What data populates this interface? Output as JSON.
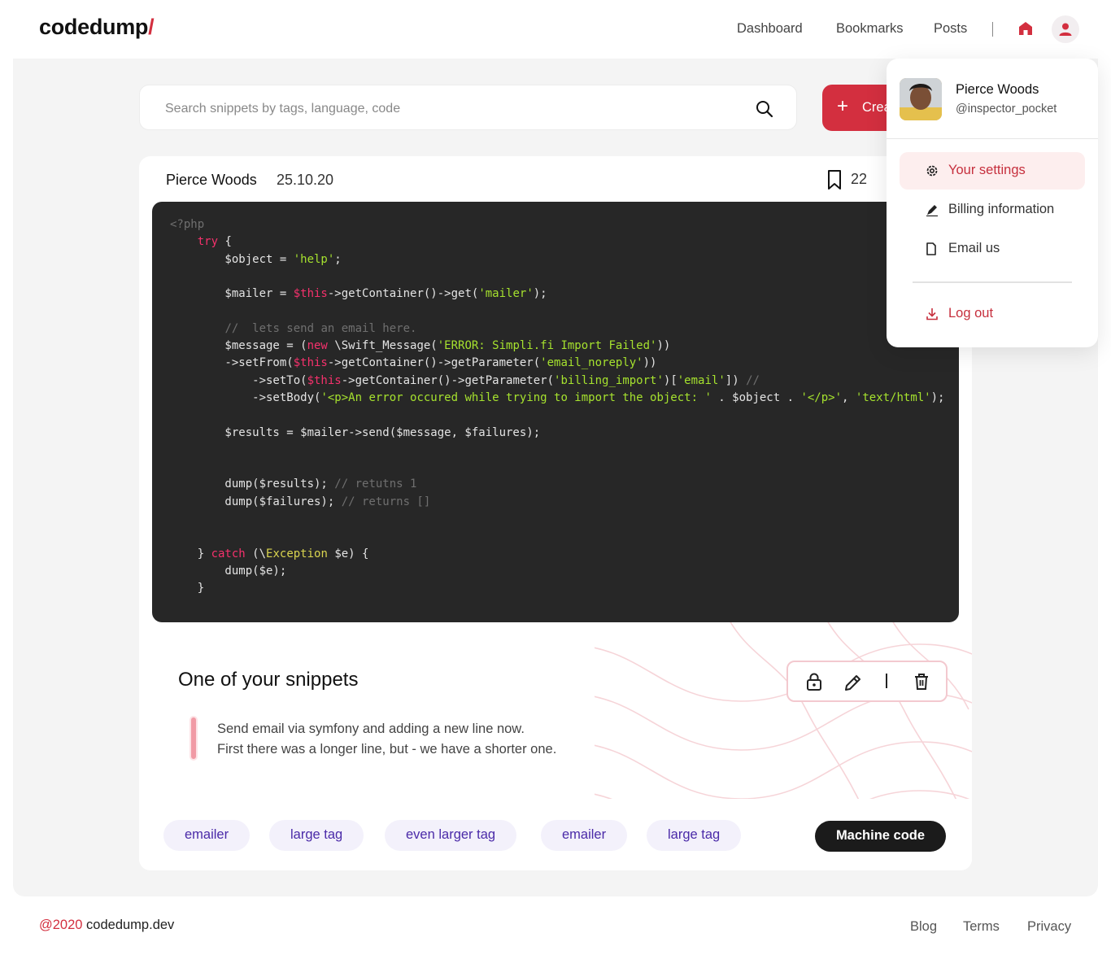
{
  "brand": {
    "name": "codedump",
    "slash": "/"
  },
  "nav": {
    "dashboard": "Dashboard",
    "bookmarks": "Bookmarks",
    "posts": "Posts"
  },
  "colors": {
    "accent": "#d32f3f",
    "tag_bg": "#f3f1fb",
    "tag_text": "#4a2aa8",
    "code_bg": "#272727"
  },
  "icons": {
    "home": "home-icon",
    "user": "user-icon",
    "search": "search-icon",
    "bookmark": "bookmark-icon"
  },
  "search": {
    "placeholder": "Search snippets by tags, language, code"
  },
  "create": {
    "label": "Create"
  },
  "snippet": {
    "author": "Pierce Woods",
    "date": "25.10.20",
    "bookmarks": "22",
    "title": "One of your snippets",
    "description_line1": "Send email via symfony and adding a new line now.",
    "description_line2": "First there was a longer line, but - we have a shorter one.",
    "language": "Machine code",
    "tags": [
      "emailer",
      "large tag",
      "even larger tag",
      "emailer",
      "large tag"
    ]
  },
  "code_lines": [
    "<?php",
    "    try {",
    "        $object = 'help';",
    "",
    "        $mailer = $this->getContainer()->get('mailer');",
    "",
    "        //  lets send an email here.",
    "        $message = (new \\Swift_Message('ERROR: Simpli.fi Import Failed'))",
    "        ->setFrom($this->getContainer()->getParameter('email_noreply'))",
    "            ->setTo($this->getContainer()->getParameter('billing_import')['email']) //",
    "            ->setBody('<p>An error occured while trying to import the object: ' . $object . '</p>', 'text/html');",
    "",
    "        $results = $mailer->send($message, $failures);",
    "",
    "",
    "        dump($results); // retutns 1",
    "        dump($failures); // returns []",
    "",
    "",
    "    } catch (\\Exception $e) {",
    "        dump($e);",
    "    }"
  ],
  "dropdown": {
    "name": "Pierce Woods",
    "handle": "@inspector_pocket",
    "settings": "Your settings",
    "billing": "Billing information",
    "email": "Email us",
    "logout": "Log out"
  },
  "footer": {
    "year": "@2020",
    "site": " codedump.dev",
    "blog": "Blog",
    "terms": "Terms",
    "privacy": "Privacy"
  }
}
